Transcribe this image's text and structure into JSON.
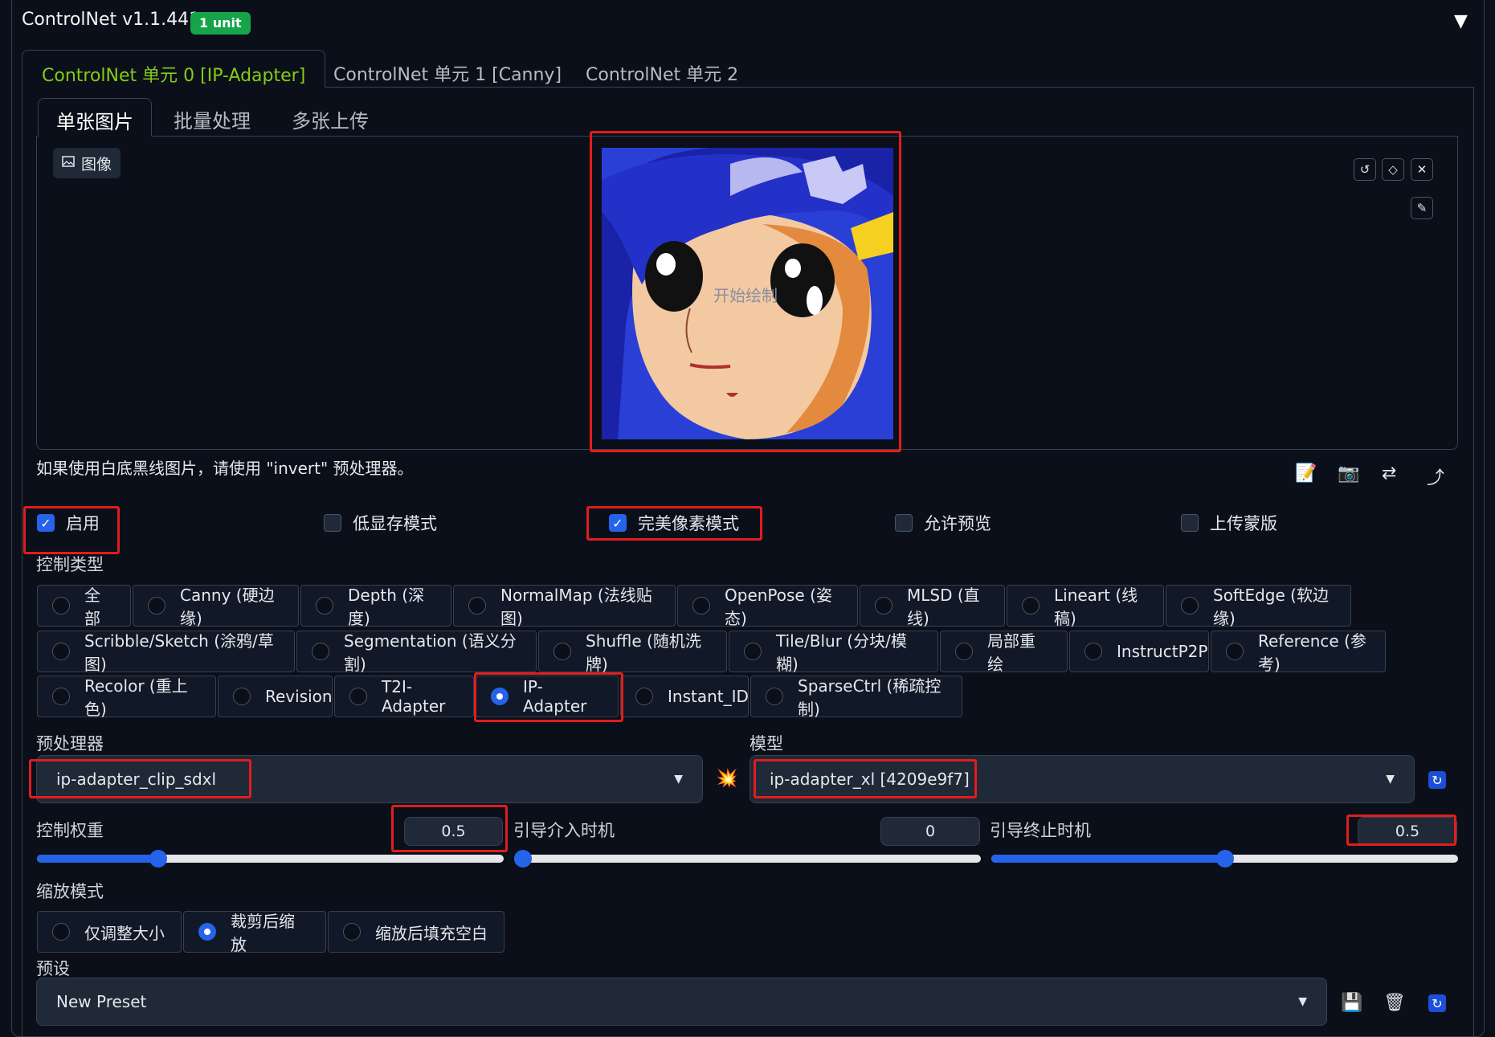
{
  "header": {
    "title": "ControlNet v1.1.441",
    "badge": "1 unit",
    "collapse_icon": "▼"
  },
  "unit_tabs": [
    "ControlNet 单元 0 [IP-Adapter]",
    "ControlNet 单元 1 [Canny]",
    "ControlNet 单元 2"
  ],
  "image_tabs": [
    "单张图片",
    "批量处理",
    "多张上传"
  ],
  "image_panel": {
    "label": "图像",
    "canvas_hint": "开始绘制"
  },
  "hint_text": "如果使用白底黑线图片，请使用 \"invert\" 预处理器。",
  "checkboxes": [
    {
      "label": "启用",
      "checked": true
    },
    {
      "label": "低显存模式",
      "checked": false
    },
    {
      "label": "完美像素模式",
      "checked": true
    },
    {
      "label": "允许预览",
      "checked": false
    },
    {
      "label": "上传蒙版",
      "checked": false
    }
  ],
  "control_type": {
    "label": "控制类型",
    "row1": [
      "全部",
      "Canny (硬边缘)",
      "Depth (深度)",
      "NormalMap (法线贴图)",
      "OpenPose (姿态)",
      "MLSD (直线)",
      "Lineart (线稿)",
      "SoftEdge (软边缘)"
    ],
    "row2": [
      "Scribble/Sketch (涂鸦/草图)",
      "Segmentation (语义分割)",
      "Shuffle (随机洗牌)",
      "Tile/Blur (分块/模糊)",
      "局部重绘",
      "InstructP2P",
      "Reference (参考)"
    ],
    "row3": [
      "Recolor (重上色)",
      "Revision",
      "T2I-Adapter",
      "IP-Adapter",
      "Instant_ID",
      "SparseCtrl (稀疏控制)"
    ],
    "selected": "IP-Adapter"
  },
  "preprocessor": {
    "label": "预处理器",
    "value": "ip-adapter_clip_sdxl"
  },
  "model": {
    "label": "模型",
    "value": "ip-adapter_xl [4209e9f7]"
  },
  "sliders": {
    "weight": {
      "label": "控制权重",
      "value": "0.5",
      "fraction": 0.26
    },
    "start": {
      "label": "引导介入时机",
      "value": "0",
      "fraction": 0.0
    },
    "end": {
      "label": "引导终止时机",
      "value": "0.5",
      "fraction": 0.5
    }
  },
  "resize_mode": {
    "label": "缩放模式",
    "options": [
      "仅调整大小",
      "裁剪后缩放",
      "缩放后填充空白"
    ],
    "selected": "裁剪后缩放"
  },
  "preset": {
    "label": "预设",
    "value": "New Preset"
  },
  "colors": {
    "accent_blue": "#2563eb",
    "active_tab_green": "#84cc16",
    "highlight_red": "#e11d1d",
    "badge_green": "#16a34a"
  }
}
